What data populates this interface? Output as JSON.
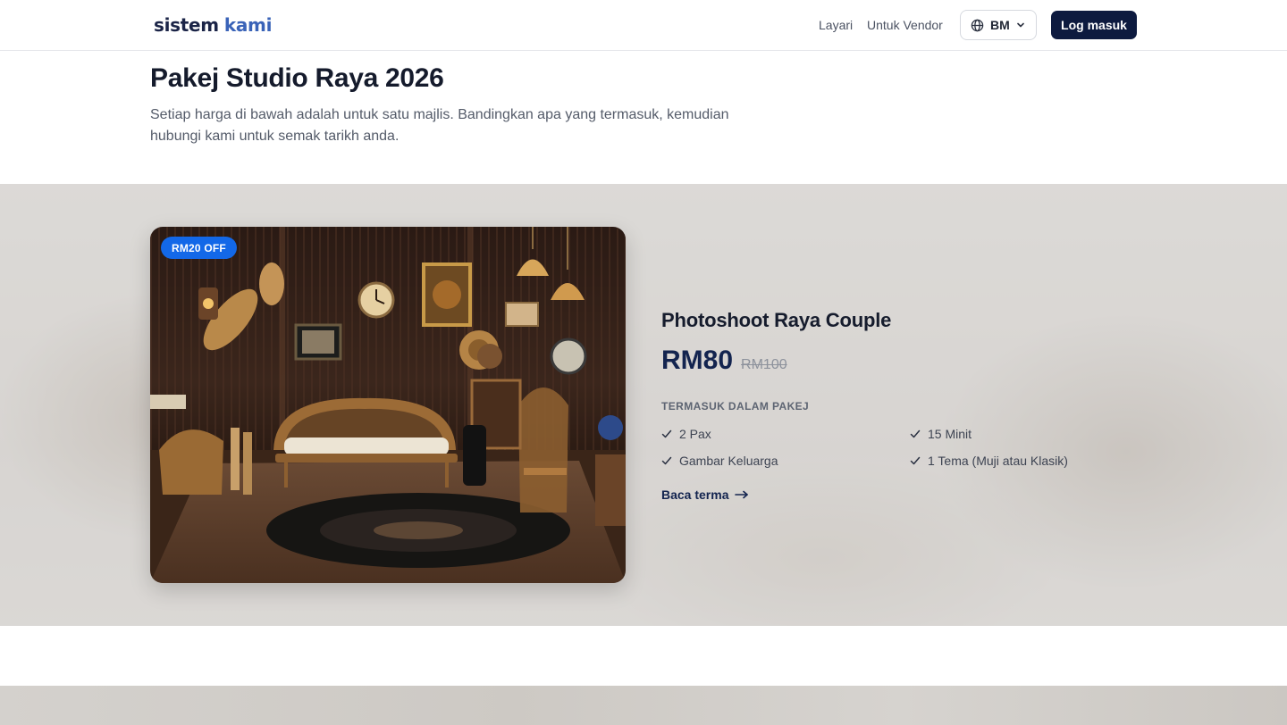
{
  "header": {
    "logo_word1": "sistem",
    "logo_word2": "kami",
    "nav": [
      {
        "label": "Layari"
      },
      {
        "label": "Untuk Vendor"
      }
    ],
    "language": {
      "label": "BM",
      "icon": "globe-icon"
    },
    "login_label": "Log masuk"
  },
  "intro": {
    "title": "Pakej Studio Raya 2026",
    "description": "Setiap harga di bawah adalah untuk satu majlis. Bandingkan apa yang termasuk, kemudian hubungi kami untuk semak tarikh anda."
  },
  "package": {
    "badge": "RM20 OFF",
    "name": "Photoshoot Raya Couple",
    "price": "RM80",
    "original_price": "RM100",
    "included_label": "TERMASUK DALAM PAKEJ",
    "features": [
      "2 Pax",
      "15 Minit",
      "Gambar Keluarga",
      "1 Tema (Muji atau Klasik)"
    ],
    "terms_label": "Baca terma",
    "terms_icon": "arrow-right-icon"
  },
  "colors": {
    "brand_dark": "#0d1a3f",
    "brand_blue": "#3a63b8",
    "badge_blue": "#1368e8",
    "price_navy": "#13244f"
  }
}
